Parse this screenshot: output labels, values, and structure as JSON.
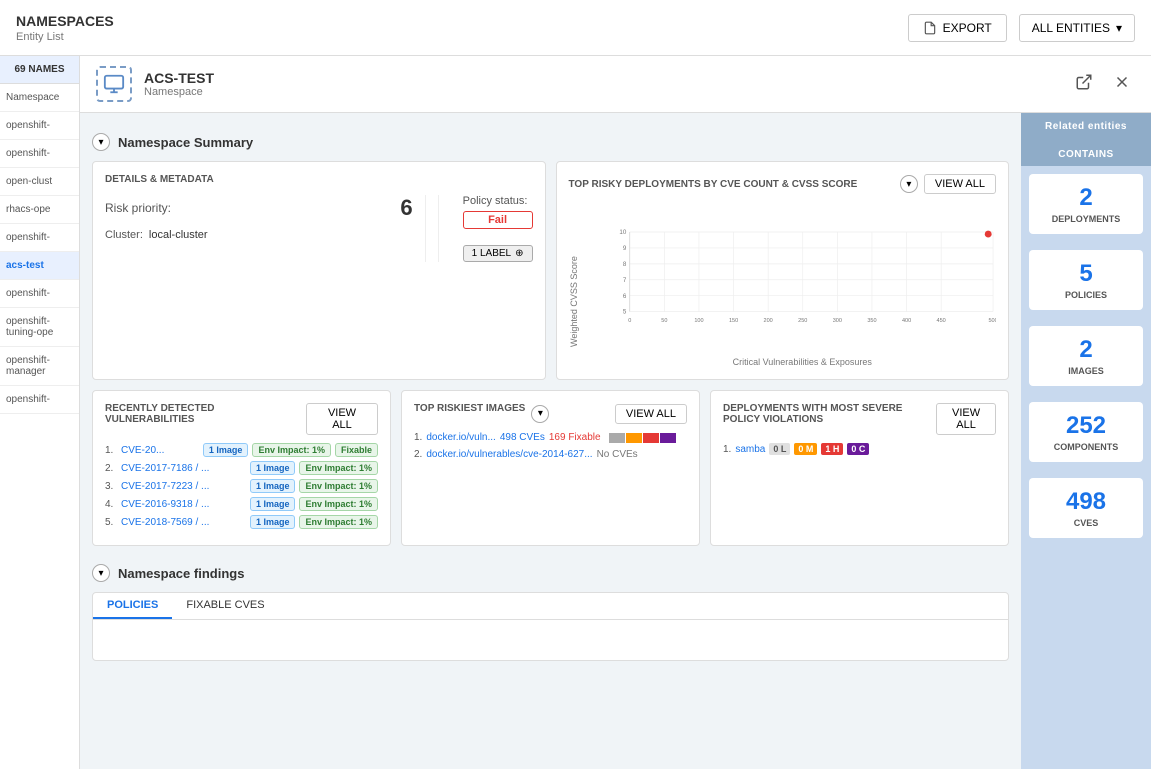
{
  "app": {
    "title": "NAMESPACES",
    "subtitle": "Entity List",
    "export_label": "EXPORT",
    "all_entities_label": "ALL ENTITIES"
  },
  "sidebar": {
    "header": "69 NAMES",
    "items": [
      {
        "label": "Namespace",
        "active": false
      },
      {
        "label": "openshift-",
        "active": false
      },
      {
        "label": "openshift-",
        "active": false
      },
      {
        "label": "open-clust",
        "active": false
      },
      {
        "label": "rhacs-ope",
        "active": false
      },
      {
        "label": "openshift-",
        "active": false
      },
      {
        "label": "acs-test",
        "active": true
      },
      {
        "label": "openshift-",
        "active": false
      },
      {
        "label": "openshift-",
        "active": false
      },
      {
        "label": "openshift-",
        "active": false
      }
    ]
  },
  "entity": {
    "name": "ACS-TEST",
    "type": "Namespace"
  },
  "namespace_summary": {
    "title": "Namespace Summary",
    "details_metadata": {
      "card_title": "DETAILS & METADATA",
      "risk_label": "Risk priority:",
      "risk_value": "6",
      "policy_status_label": "Policy status:",
      "policy_status_value": "Fail",
      "cluster_label": "Cluster:",
      "cluster_value": "local-cluster",
      "label_badge": "1 LABEL"
    },
    "chart": {
      "title": "TOP RISKY DEPLOYMENTS BY CVE COUNT & CVSS SCORE",
      "view_all": "VIEW ALL",
      "y_label": "Weighted CVSS Score",
      "x_label": "Critical Vulnerabilities & Exposures",
      "y_ticks": [
        5,
        6,
        7,
        8,
        9,
        10
      ],
      "x_ticks": [
        0,
        50,
        100,
        150,
        200,
        250,
        300,
        350,
        400,
        450,
        500
      ],
      "data_point": {
        "x": 490,
        "y": 9.7
      }
    }
  },
  "vulnerabilities": {
    "title": "RECENTLY DETECTED VULNERABILITIES",
    "view_all": "VIEW ALL",
    "items": [
      {
        "num": "1.",
        "name": "CVE-20...",
        "image": "1 Image",
        "env": "Env Impact: 1%",
        "fixable": "Fixable"
      },
      {
        "num": "2.",
        "name": "CVE-2017-7186 / ...",
        "image": "1 Image",
        "env": "Env Impact: 1%",
        "fixable": null
      },
      {
        "num": "3.",
        "name": "CVE-2017-7223 / ...",
        "image": "1 Image",
        "env": "Env Impact: 1%",
        "fixable": null
      },
      {
        "num": "4.",
        "name": "CVE-2016-9318 / ...",
        "image": "1 Image",
        "env": "Env Impact: 1%",
        "fixable": null
      },
      {
        "num": "5.",
        "name": "CVE-2018-7569 / ...",
        "image": "1 Image",
        "env": "Env Impact: 1%",
        "fixable": null
      }
    ]
  },
  "top_riskiest_images": {
    "title": "TOP RISKIEST IMAGES",
    "view_all": "VIEW ALL",
    "items": [
      {
        "num": "1.",
        "name": "docker.io/vuln...",
        "cves": "498 CVEs",
        "fixable": "169 Fixable",
        "has_bar": true
      },
      {
        "num": "2.",
        "name": "docker.io/vulnerables/cve-2014-627...",
        "cves_label": "No CVEs",
        "has_bar": false
      }
    ]
  },
  "policy_violations": {
    "title": "DEPLOYMENTS WITH MOST SEVERE POLICY VIOLATIONS",
    "view_all": "VIEW ALL",
    "items": [
      {
        "num": "1.",
        "name": "samba",
        "sev_l": "0 L",
        "sev_m": "0 M",
        "sev_h": "1 H",
        "sev_c": "0 C"
      }
    ]
  },
  "related_entities": {
    "title": "Related entities",
    "contains_label": "CONTAINS",
    "items": [
      {
        "value": "2",
        "label": "DEPLOYMENTS"
      },
      {
        "value": "5",
        "label": "POLICIES"
      },
      {
        "value": "2",
        "label": "IMAGES"
      },
      {
        "value": "252",
        "label": "COMPONENTS"
      },
      {
        "value": "498",
        "label": "CVES"
      }
    ]
  },
  "namespace_findings": {
    "title": "Namespace findings",
    "tabs": [
      {
        "label": "POLICIES",
        "active": true
      },
      {
        "label": "FIXABLE CVES",
        "active": false
      }
    ]
  }
}
